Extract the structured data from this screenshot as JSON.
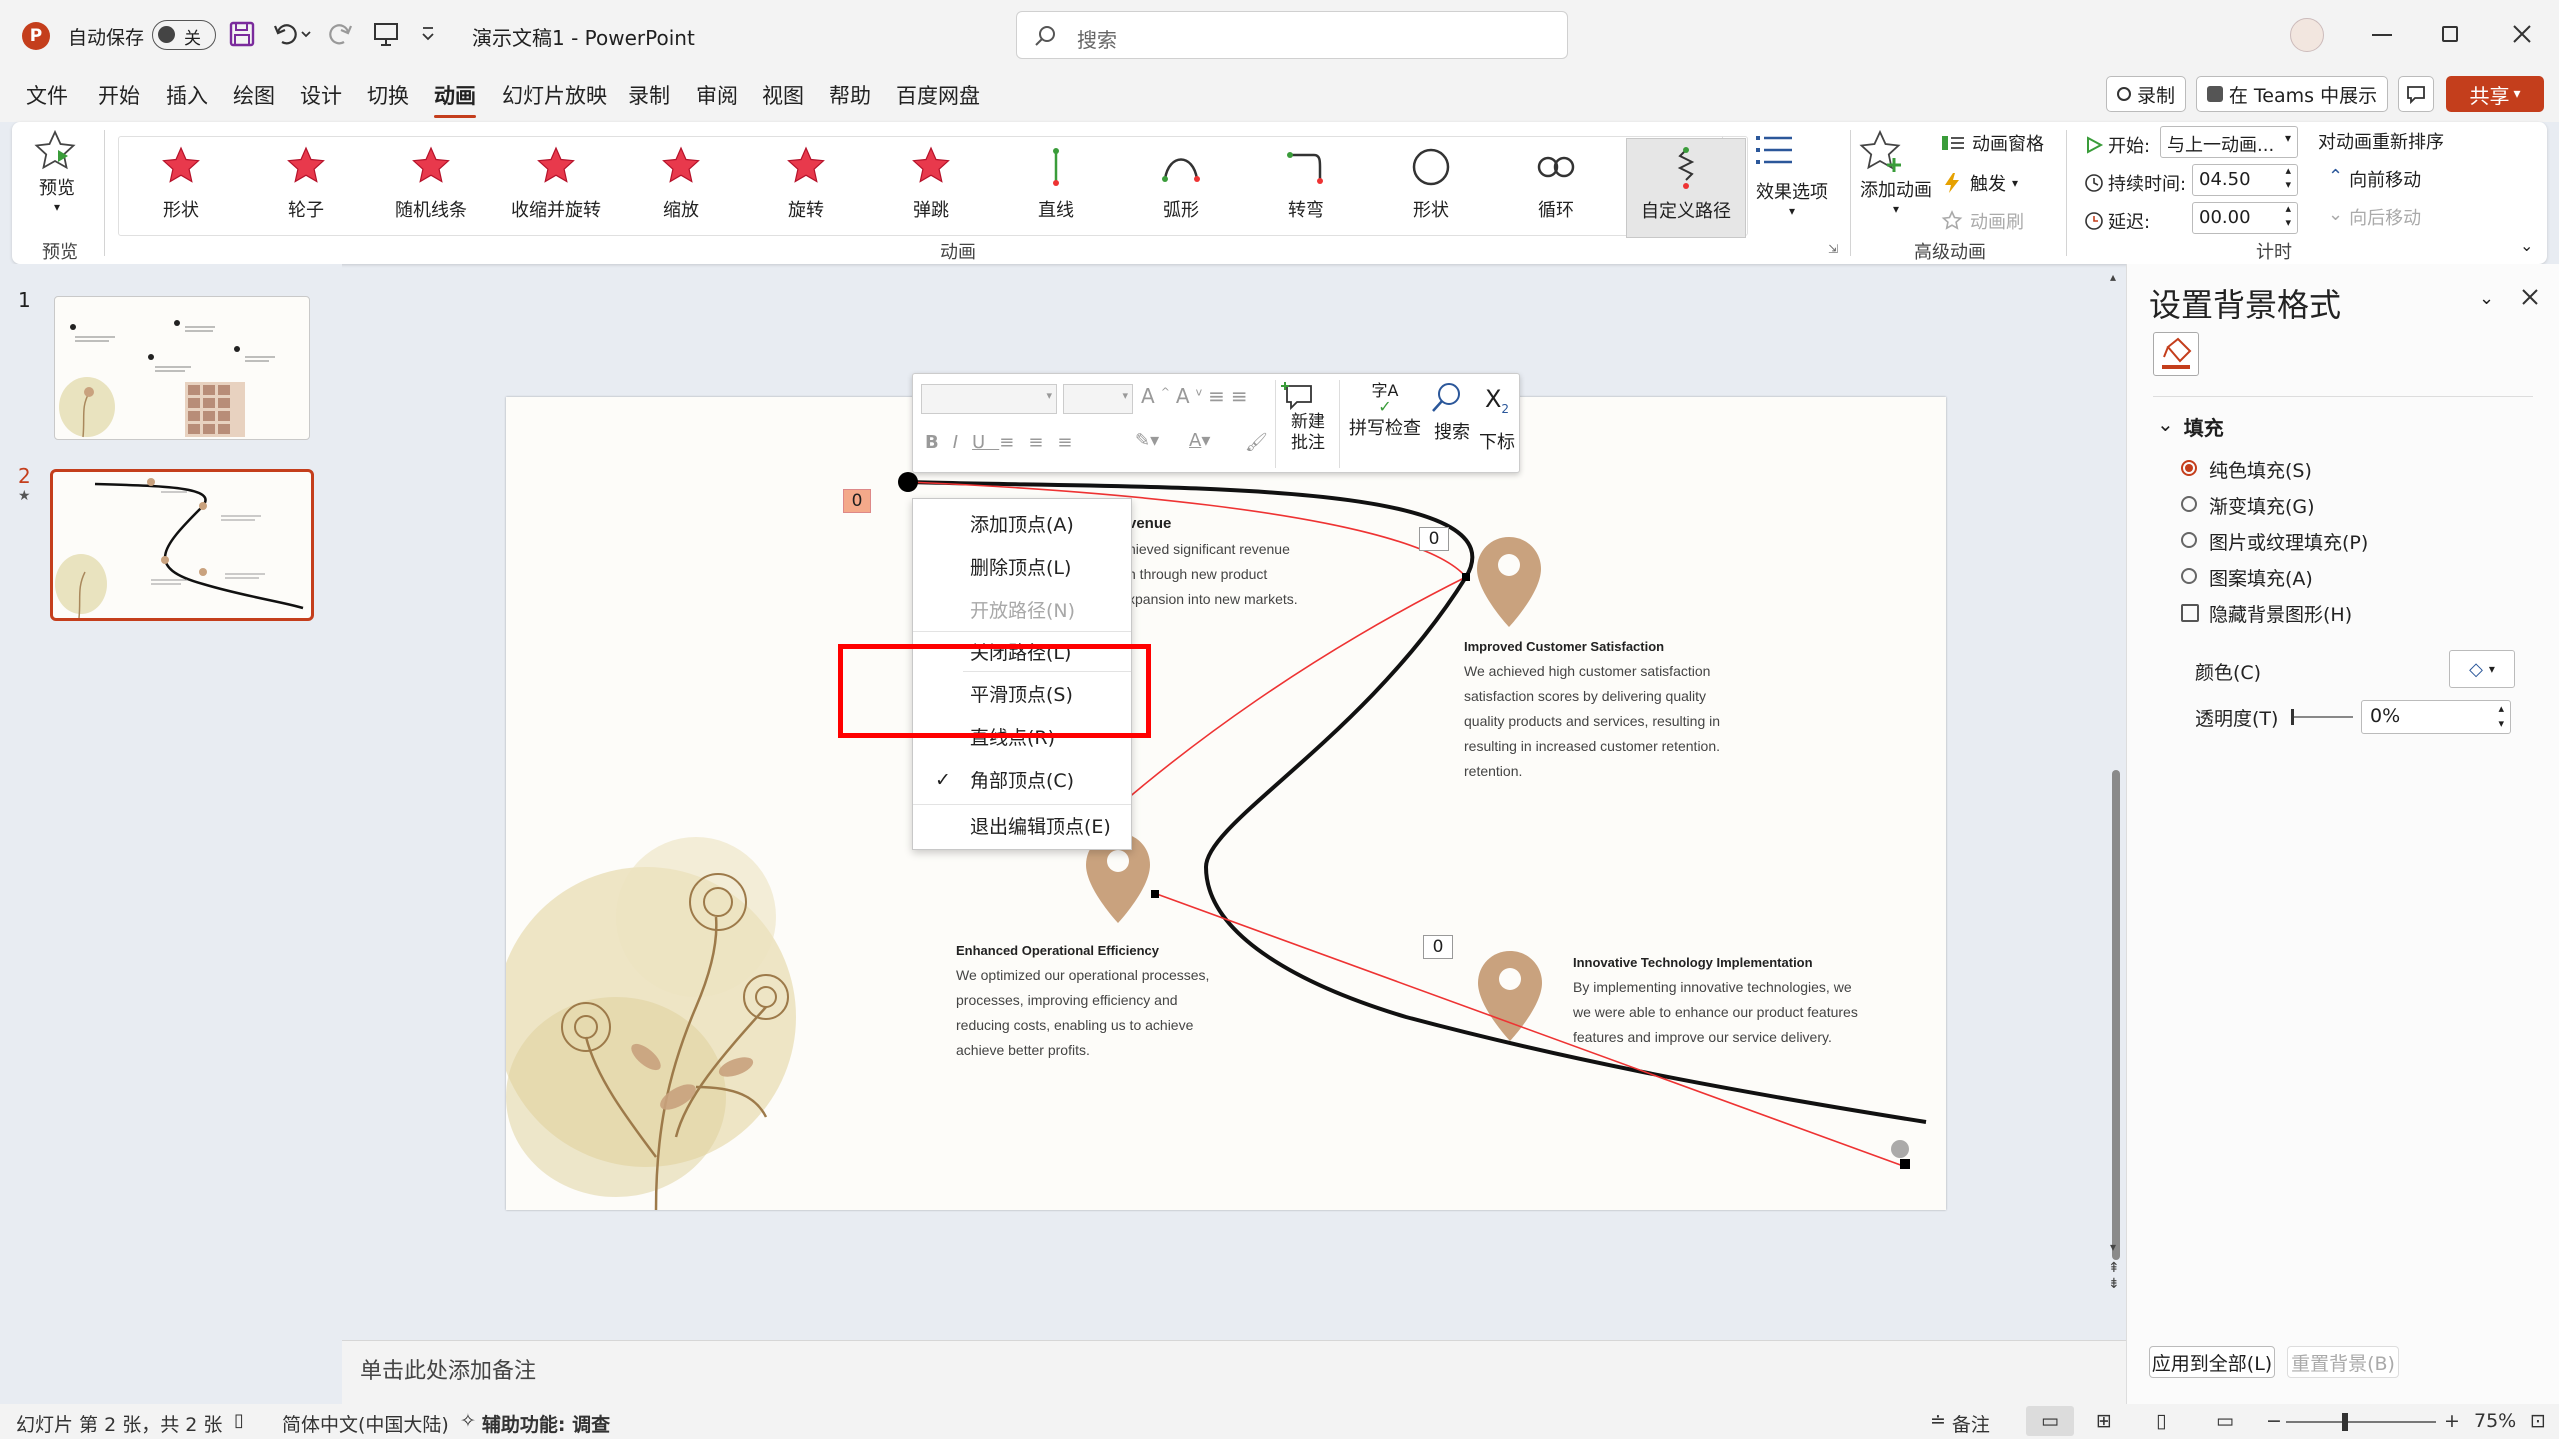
{
  "titlebar": {
    "autosave_label": "自动保存",
    "autosave_state": "关",
    "doc_title": "演示文稿1  -  PowerPoint",
    "search_placeholder": "搜索"
  },
  "tabs": [
    "文件",
    "开始",
    "插入",
    "绘图",
    "设计",
    "切换",
    "动画",
    "幻灯片放映",
    "录制",
    "审阅",
    "视图",
    "帮助",
    "百度网盘"
  ],
  "active_tab": "动画",
  "header_buttons": {
    "record": "录制",
    "present_teams": "在 Teams 中展示",
    "share": "共享"
  },
  "ribbon": {
    "preview_label": "预览",
    "preview_group": "预览",
    "animation_group": "动画",
    "gallery": [
      "形状",
      "轮子",
      "随机线条",
      "收缩并旋转",
      "缩放",
      "旋转",
      "弹跳",
      "直线",
      "弧形",
      "转弯",
      "形状",
      "循环",
      "自定义路径"
    ],
    "effect_options": "效果选项",
    "add_animation": "添加动画",
    "animation_pane": "动画窗格",
    "trigger": "触发",
    "animation_painter": "动画刷",
    "advanced_group": "高级动画",
    "start_label": "开始:",
    "start_value": "与上一动画...",
    "duration_label": "持续时间:",
    "duration_value": "04.50",
    "delay_label": "延迟:",
    "delay_value": "00.00",
    "reorder_title": "对动画重新排序",
    "move_earlier": "向前移动",
    "move_later": "向后移动",
    "timing_group": "计时"
  },
  "thumbnails": [
    {
      "number": "1"
    },
    {
      "number": "2"
    }
  ],
  "slide": {
    "title_fragment": "venue",
    "frag1": "hieved significant revenue",
    "frag2": "n through new product",
    "frag3": "xpansion into new markets.",
    "b2_title": "Improved Customer Satisfaction",
    "b2_lines": [
      "We achieved high customer satisfaction",
      "satisfaction scores by delivering quality",
      "quality products and services, resulting in",
      "resulting in increased customer retention.",
      "retention."
    ],
    "b3_title": "Enhanced Operational Efficiency",
    "b3_lines": [
      "We optimized our operational processes,",
      "processes, improving efficiency and",
      "reducing costs, enabling us to achieve",
      "achieve better profits."
    ],
    "b4_title": "Innovative Technology Implementation",
    "b4_lines": [
      "By implementing innovative technologies, we",
      "we were able to enhance our product features",
      "features and improve our service delivery."
    ],
    "anim_tag_start": "0",
    "anim_tag_2": "0",
    "anim_tag_3": "0"
  },
  "mini_toolbar": {
    "new_comment": "新建批注",
    "spell_check": "拼写检查",
    "search": "搜索",
    "subscript": "下标",
    "spell_glyph": "字A"
  },
  "context_menu": [
    {
      "label": "添加顶点(A)",
      "disabled": false
    },
    {
      "label": "删除顶点(L)",
      "disabled": false
    },
    {
      "label": "开放路径(N)",
      "disabled": true
    },
    {
      "label": "关闭路径(L)",
      "disabled": false
    },
    {
      "label": "平滑顶点(S)",
      "disabled": false
    },
    {
      "label": "直线点(R)",
      "disabled": false
    },
    {
      "label": "角部顶点(C)",
      "disabled": false,
      "checked": true
    },
    {
      "label": "退出编辑顶点(E)",
      "disabled": false
    }
  ],
  "notes_placeholder": "单击此处添加备注",
  "pane": {
    "title": "设置背景格式",
    "section": "填充",
    "options": [
      "纯色填充(S)",
      "渐变填充(G)",
      "图片或纹理填充(P)",
      "图案填充(A)"
    ],
    "selected_option": "纯色填充(S)",
    "hide_bg": "隐藏背景图形(H)",
    "color_label": "颜色(C)",
    "transparency_label": "透明度(T)",
    "transparency_value": "0%",
    "apply_all": "应用到全部(L)",
    "reset_bg": "重置背景(B)"
  },
  "statusbar": {
    "slide_info": "幻灯片 第 2 张，共 2 张",
    "language": "简体中文(中国大陆)",
    "accessibility": "辅助功能: 调查",
    "notes": "备注",
    "zoom": "75%"
  },
  "colors": {
    "accent": "#c43e1c",
    "highlight": "#ff0000",
    "pin": "#c9a27e",
    "share": "#c43e1c"
  }
}
